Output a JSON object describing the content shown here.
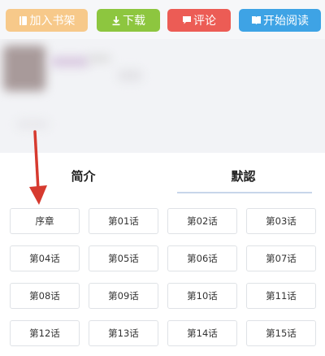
{
  "actions": {
    "add_shelf": "加入书架",
    "download": "下载",
    "comment": "评论",
    "start_reading": "开始阅读"
  },
  "tabs": {
    "intro": "简介",
    "catalog": "默認"
  },
  "chapters": [
    "序章",
    "第01话",
    "第02话",
    "第03话",
    "第04话",
    "第05话",
    "第06话",
    "第07话",
    "第08话",
    "第09话",
    "第10话",
    "第11话",
    "第12话",
    "第13话",
    "第14话",
    "第15话"
  ],
  "colors": {
    "add_shelf": "#f7c98a",
    "download": "#8dc63f",
    "comment": "#ec5c55",
    "start_reading": "#3ea3e5",
    "annotation_arrow": "#d63a2f"
  },
  "icons": {
    "add_shelf": "book-icon",
    "download": "download-icon",
    "comment": "comment-icon",
    "start_reading": "open-book-icon"
  }
}
